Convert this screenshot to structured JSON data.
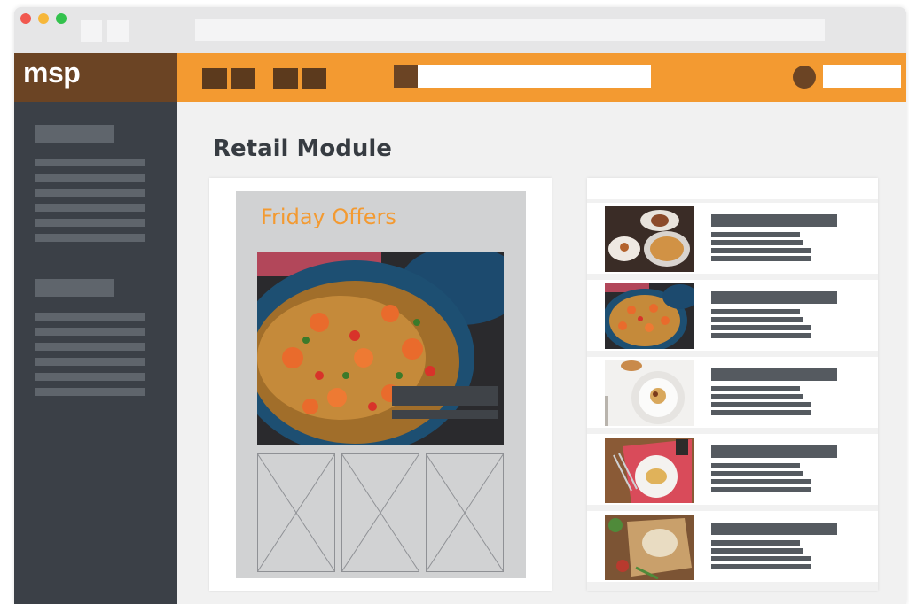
{
  "browser": {
    "controls": [
      "close",
      "minimize",
      "maximize"
    ],
    "nav_buttons": [
      "back",
      "forward"
    ],
    "address_placeholder": true
  },
  "app": {
    "logo": "msp",
    "brand_colors": {
      "header": "#f39a31",
      "logo_bg": "#6b4424",
      "sidebar": "#3b4047"
    }
  },
  "main": {
    "page_title": "Retail Module",
    "offers_card": {
      "title": "Friday Offers",
      "feature_image": "paella-dish-photo",
      "placeholders": [
        "image-placeholder",
        "image-placeholder",
        "image-placeholder"
      ]
    },
    "product_list": {
      "items": [
        {
          "image": "seafood-gratin-photo"
        },
        {
          "image": "paella-dish-photo"
        },
        {
          "image": "plated-scallop-photo"
        },
        {
          "image": "pasta-table-photo"
        },
        {
          "image": "noodle-board-photo"
        }
      ]
    }
  }
}
